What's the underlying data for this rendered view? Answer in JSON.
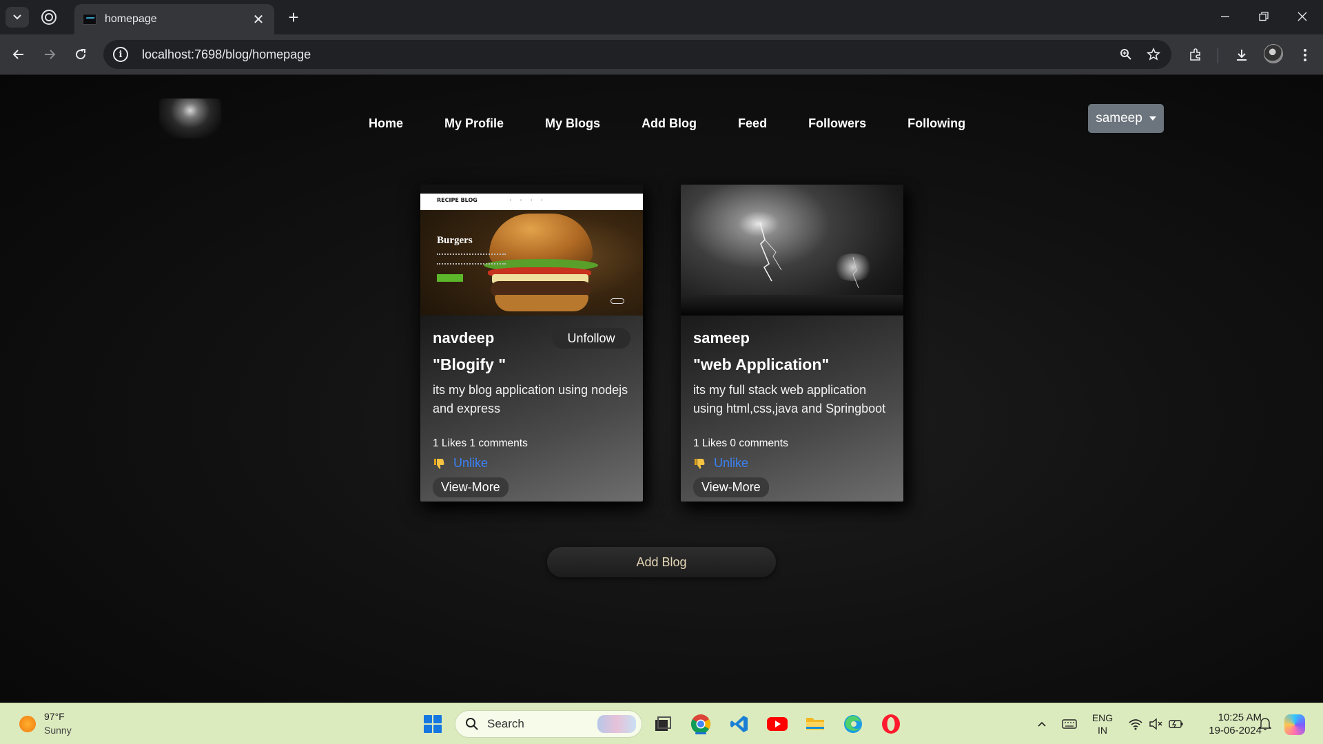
{
  "browser": {
    "tab_title": "homepage",
    "url": "localhost:7698/blog/homepage",
    "new_tab_symbol": "+",
    "close_symbol": "✕"
  },
  "site": {
    "nav": [
      "Home",
      "My Profile",
      "My Blogs",
      "Add Blog",
      "Feed",
      "Followers",
      "Following"
    ],
    "user_menu": "sameep"
  },
  "posts": [
    {
      "author": "navdeep",
      "follow_label": "Unfollow",
      "title": "\"Blogify \"",
      "description": "its my blog application using nodejs and express",
      "stats": "1 Likes 1 comments",
      "like_action": "Unlike",
      "view_more": "View-More",
      "image_texts": {
        "logo": "RECIPE BLOG",
        "heading": "Burgers"
      }
    },
    {
      "author": "sameep",
      "title": "\"web Application\"",
      "description": "its my full stack web application using html,css,java and Springboot",
      "stats": "1 Likes 0 comments",
      "like_action": "Unlike",
      "view_more": "View-More"
    }
  ],
  "add_blog_button": "Add Blog",
  "taskbar": {
    "weather_temp": "97°F",
    "weather_condition": "Sunny",
    "search_placeholder": "Search",
    "language_line1": "ENG",
    "language_line2": "IN",
    "time": "10:25 AM",
    "date": "19-06-2024"
  },
  "colors": {
    "link": "#3b82f6",
    "dropdown": "#6c757d",
    "taskbar": "#dcebbe"
  }
}
